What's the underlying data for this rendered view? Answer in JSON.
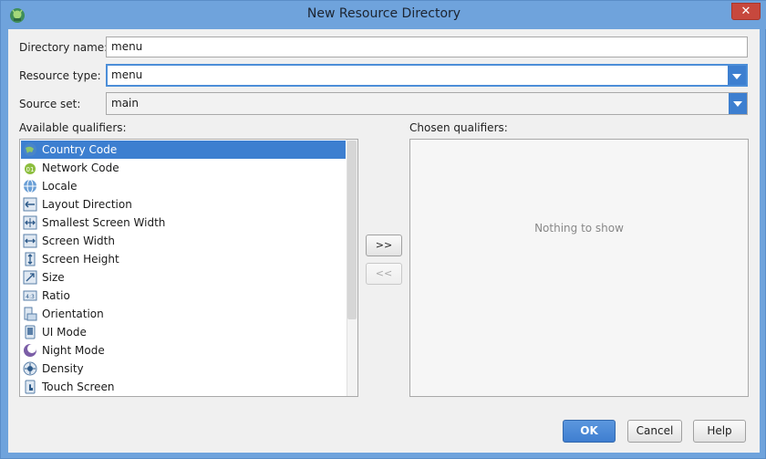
{
  "window": {
    "title": "New Resource Directory",
    "close_label": "✕"
  },
  "form": {
    "directory_name_label": "Directory name:",
    "directory_name_value": "menu",
    "resource_type_label": "Resource type:",
    "resource_type_value": "menu",
    "source_set_label": "Source set:",
    "source_set_value": "main"
  },
  "available": {
    "label": "Available qualifiers:",
    "items": [
      {
        "label": "Country Code",
        "icon": "globe-icon",
        "selected": true
      },
      {
        "label": "Network Code",
        "icon": "network-icon"
      },
      {
        "label": "Locale",
        "icon": "locale-globe-icon"
      },
      {
        "label": "Layout Direction",
        "icon": "layout-direction-icon"
      },
      {
        "label": "Smallest Screen Width",
        "icon": "smallest-width-icon"
      },
      {
        "label": "Screen Width",
        "icon": "screen-width-icon"
      },
      {
        "label": "Screen Height",
        "icon": "screen-height-icon"
      },
      {
        "label": "Size",
        "icon": "size-icon"
      },
      {
        "label": "Ratio",
        "icon": "ratio-icon"
      },
      {
        "label": "Orientation",
        "icon": "orientation-icon"
      },
      {
        "label": "UI Mode",
        "icon": "ui-mode-icon"
      },
      {
        "label": "Night Mode",
        "icon": "night-mode-icon"
      },
      {
        "label": "Density",
        "icon": "density-icon"
      },
      {
        "label": "Touch Screen",
        "icon": "touch-screen-icon"
      }
    ]
  },
  "chosen": {
    "label": "Chosen qualifiers:",
    "empty_text": "Nothing to show"
  },
  "move": {
    "add_label": ">>",
    "remove_label": "<<"
  },
  "buttons": {
    "ok": "OK",
    "cancel": "Cancel",
    "help": "Help"
  },
  "colors": {
    "accent": "#3d7fd0",
    "title_bar": "#6fa3dc",
    "close": "#c7483d"
  }
}
